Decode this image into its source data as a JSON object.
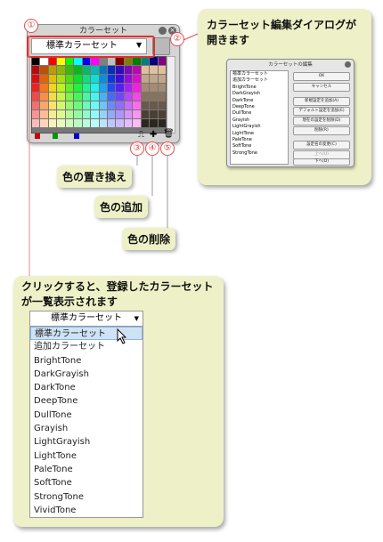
{
  "markers": [
    "①",
    "②",
    "③",
    "④",
    "⑤"
  ],
  "panel": {
    "title": "カラーセット",
    "selected_set": "標準カラーセット",
    "swatch_colors": [
      "#000000",
      "#ffffff",
      "#ff0000",
      "#ffff00",
      "#00ff00",
      "#00ffff",
      "#0000ff",
      "#ff00ff",
      "#808080",
      "#c0c0c0",
      "#800000",
      "#808000",
      "#008000",
      "#008080",
      "#000080",
      "#800080"
    ]
  },
  "callouts": {
    "edit_dialog": "カラーセット編集ダイアログが開きます",
    "dropdown_hint": "クリックすると、登録したカラーセットが一覧表示されます",
    "replace": "色の置き換え",
    "add": "色の追加",
    "delete": "色の削除"
  },
  "dialog": {
    "title": "カラーセットの編集",
    "list": [
      "標準カラーセット",
      "追加カラーセット",
      "BrightTone",
      "DarkGrayish",
      "DarkTone",
      "DeepTone",
      "DullTone",
      "Grayish",
      "LightGrayish",
      "LightTone",
      "PaleTone",
      "SoftTone",
      "StrongTone"
    ],
    "buttons": [
      "OK",
      "キャンセル",
      "新規設定を追加(A)",
      "デフォルト設定を追加(E)",
      "現在の設定を削除(D)",
      "削除(R)",
      "設定名の変更(C)",
      "上へ(U)",
      "下へ(D)"
    ]
  },
  "dropdown": {
    "value": "標準カラーセット",
    "items": [
      "標準カラーセット",
      "追加カラーセット",
      "BrightTone",
      "DarkGrayish",
      "DarkTone",
      "DeepTone",
      "DullTone",
      "Grayish",
      "LightGrayish",
      "LightTone",
      "PaleTone",
      "SoftTone",
      "StrongTone",
      "VividTone"
    ],
    "selected_index": 0
  }
}
